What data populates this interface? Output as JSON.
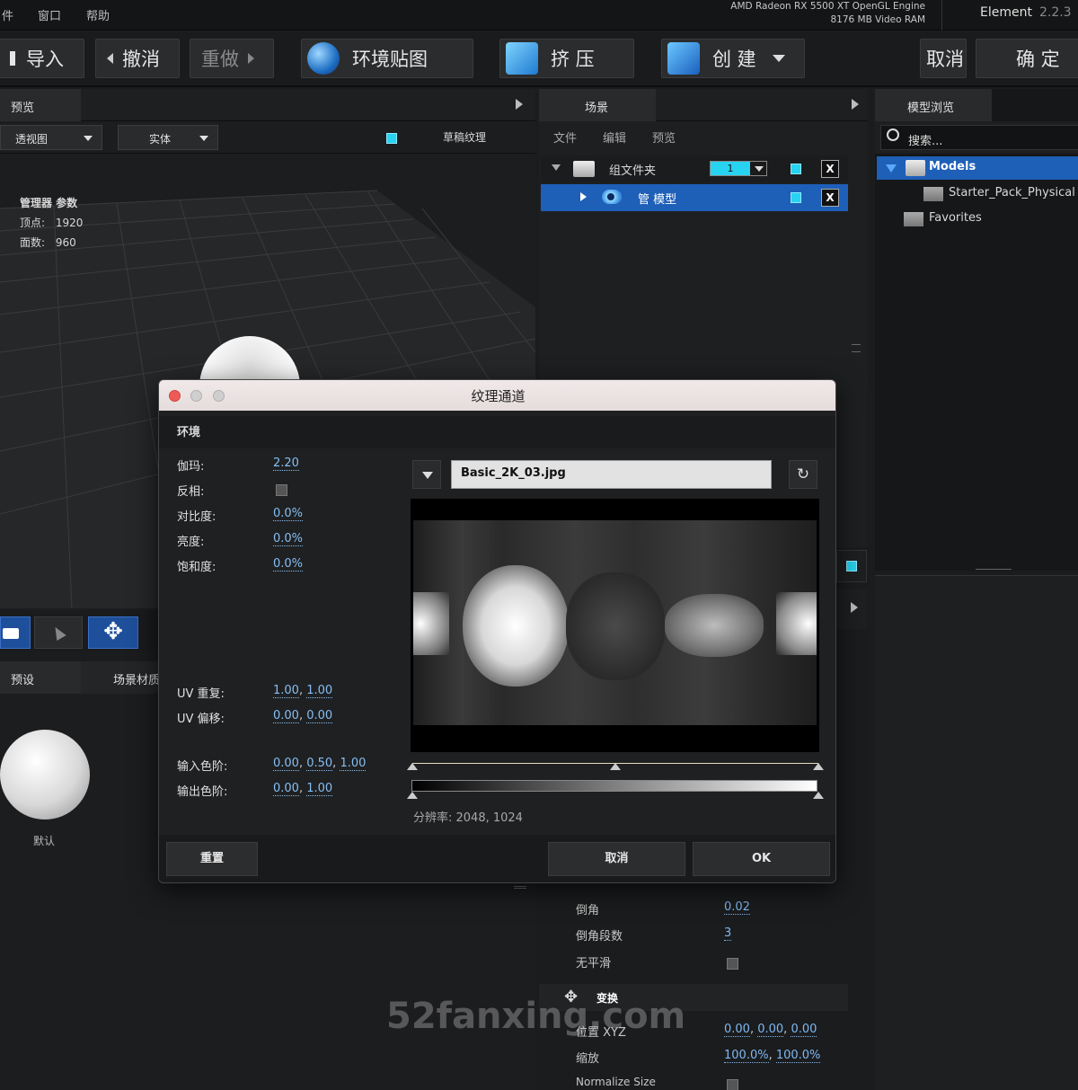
{
  "menubar": {
    "items": [
      "件",
      "窗口",
      "帮助"
    ],
    "gpu_line1": "AMD Radeon RX 5500 XT OpenGL Engine",
    "gpu_line2": "8176 MB Video RAM",
    "brand": "Element",
    "version": "2.2.3"
  },
  "toolbar": {
    "import": "导入",
    "undo": "撤消",
    "redo": "重做",
    "env_map": "环境贴图",
    "extrude": "挤 压",
    "create": "创 建",
    "cancel": "取消",
    "confirm": "确 定"
  },
  "preview": {
    "tab": "预览",
    "view_mode": "透视图",
    "shading": "实体",
    "draft_texture": "草稿纹理",
    "stats_title": "管理器 参数",
    "vertices_label": "顶点:",
    "vertices": "1920",
    "faces_label": "面数:",
    "faces": "960"
  },
  "bottom_left": {
    "tab_presets": "预设",
    "tab_scene_mat": "场景材质",
    "material_label": "默认"
  },
  "scene": {
    "tab": "场景",
    "menu_file": "文件",
    "menu_edit": "编辑",
    "menu_preview": "预览",
    "group_label": "组文件夹",
    "group_count": "1",
    "model_label": "管 模型",
    "close": "X"
  },
  "browser": {
    "tab": "模型浏览",
    "search_placeholder": "搜索...",
    "root": "Models",
    "child": "Starter_Pack_Physical (",
    "favorites": "Favorites"
  },
  "props": {
    "bevel_label": "倒角",
    "bevel": "0.02",
    "bevel_seg_label": "倒角段数",
    "bevel_seg": "3",
    "no_smooth_label": "无平滑",
    "transform_label": "变换",
    "position_label": "位置 XYZ",
    "pos_x": "0.00",
    "pos_y": "0.00",
    "pos_z": "0.00",
    "scale_label": "缩放",
    "scale_x": "100.0%",
    "scale_y": "100.0%",
    "normalize_label": "Normalize Size"
  },
  "dialog": {
    "title": "纹理通道",
    "section": "环境",
    "gamma_label": "伽玛:",
    "gamma": "2.20",
    "invert_label": "反相:",
    "contrast_label": "对比度:",
    "contrast": "0.0%",
    "brightness_label": "亮度:",
    "brightness": "0.0%",
    "saturation_label": "饱和度:",
    "saturation": "0.0%",
    "uv_repeat_label": "UV 重复:",
    "uv_repeat_u": "1.00",
    "uv_repeat_v": "1.00",
    "uv_offset_label": "UV 偏移:",
    "uv_offset_u": "0.00",
    "uv_offset_v": "0.00",
    "in_levels_label": "输入色阶:",
    "in_low": "0.00",
    "in_mid": "0.50",
    "in_high": "1.00",
    "out_levels_label": "输出色阶:",
    "out_low": "0.00",
    "out_high": "1.00",
    "file": "Basic_2K_03.jpg",
    "resolution": "分辨率: 2048, 1024",
    "reset": "重置",
    "cancel": "取消",
    "ok": "OK"
  },
  "watermark": "52fanxing.com"
}
